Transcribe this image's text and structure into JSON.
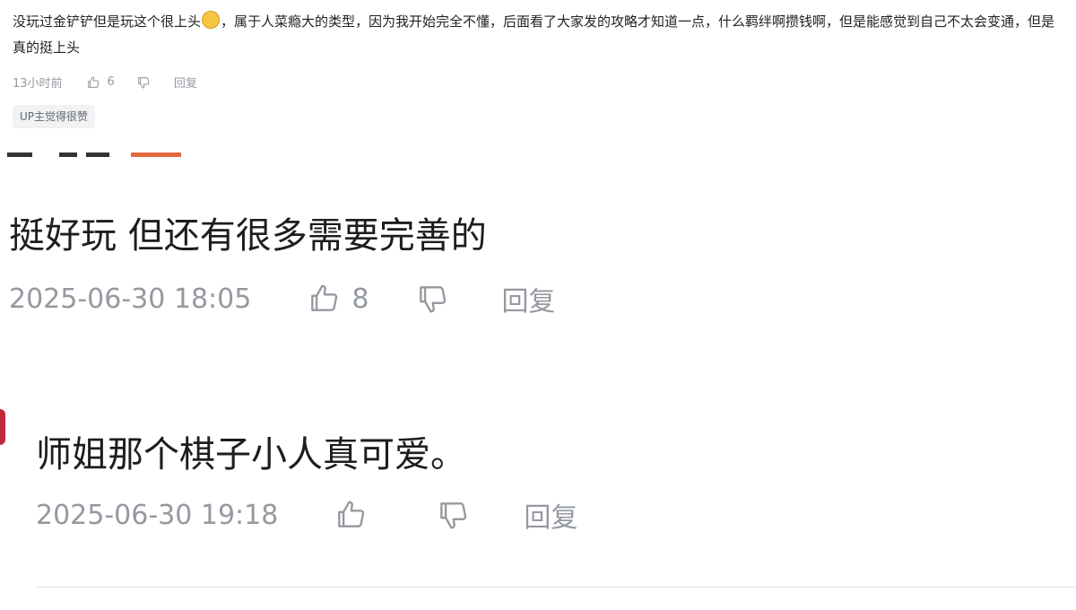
{
  "comment_1": {
    "text": "没玩过金铲铲但是玩这个很上头",
    "text_after": "，属于人菜瘾大的类型，因为我开始完全不懂，后面看了大家发的攻略才知道一点，什么羁绊啊攒钱啊，但是能感觉到自己不太会变通，但是真的挺上头",
    "time": "13小时前",
    "like_count": "6",
    "reply_label": "回复",
    "badge": "UP主觉得很赞"
  },
  "comment_2": {
    "text": "挺好玩 但还有很多需要完善的",
    "time": "2025-06-30 18:05",
    "like_count": "8",
    "reply_label": "回复"
  },
  "comment_3": {
    "text": "师姐那个棋子小人真可爱。",
    "time": "2025-06-30 19:18",
    "reply_label": "回复"
  },
  "colors": {
    "meta_gray": "#9499a0",
    "text": "#1d1d1d",
    "badge_bg": "#f1f2f3",
    "avatar_accent": "#c0283d"
  },
  "icons": [
    "thumb-up-icon",
    "thumb-down-icon",
    "emoji-icon"
  ]
}
